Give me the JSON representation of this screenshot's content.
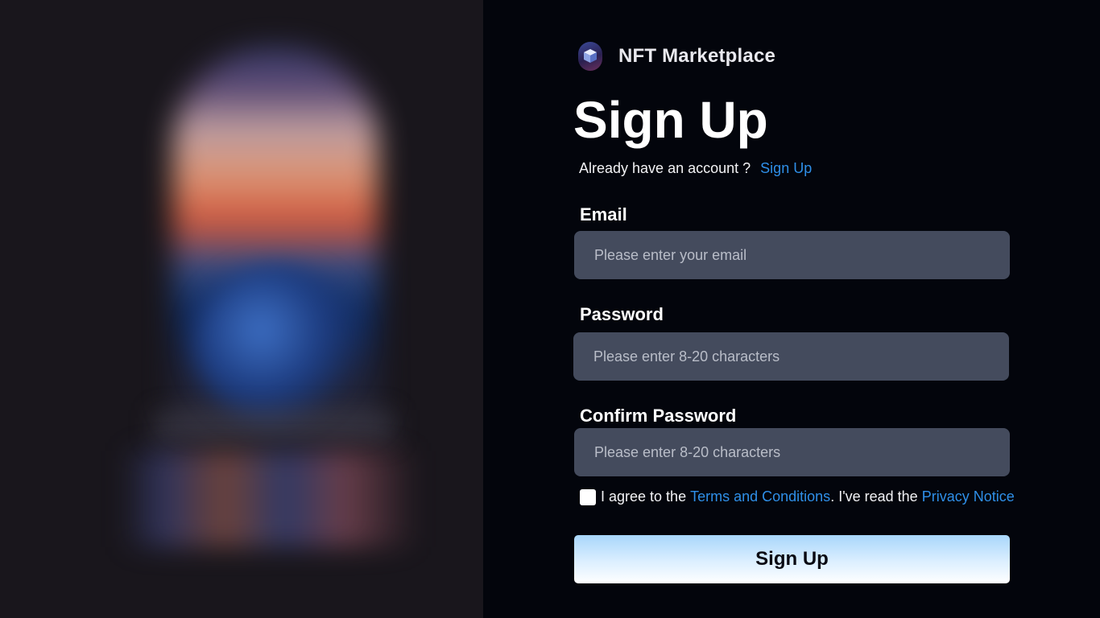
{
  "brand": {
    "name": "NFT Marketplace",
    "logo_icon": "cube-logo-icon"
  },
  "page": {
    "title": "Sign Up",
    "account_prompt": "Already have an account ?",
    "account_link": "Sign Up"
  },
  "form": {
    "email": {
      "label": "Email",
      "placeholder": "Please enter your email",
      "value": ""
    },
    "password": {
      "label": "Password",
      "placeholder": "Please enter 8-20 characters",
      "value": ""
    },
    "confirm_password": {
      "label": "Confirm Password",
      "placeholder": "Please enter 8-20 characters",
      "value": ""
    },
    "agreement": {
      "checked": false,
      "prefix": "I agree to the",
      "terms_link": "Terms and Conditions",
      "middle": ". I've read the",
      "privacy_link": "Privacy Notice"
    },
    "submit_label": "Sign Up"
  },
  "colors": {
    "background": "#03050c",
    "input_background": "#444b5d",
    "link": "#2f8fe8",
    "button_gradient_top": "#a8d6fb",
    "button_gradient_bottom": "#ffffff",
    "left_panel": "#19161c"
  }
}
